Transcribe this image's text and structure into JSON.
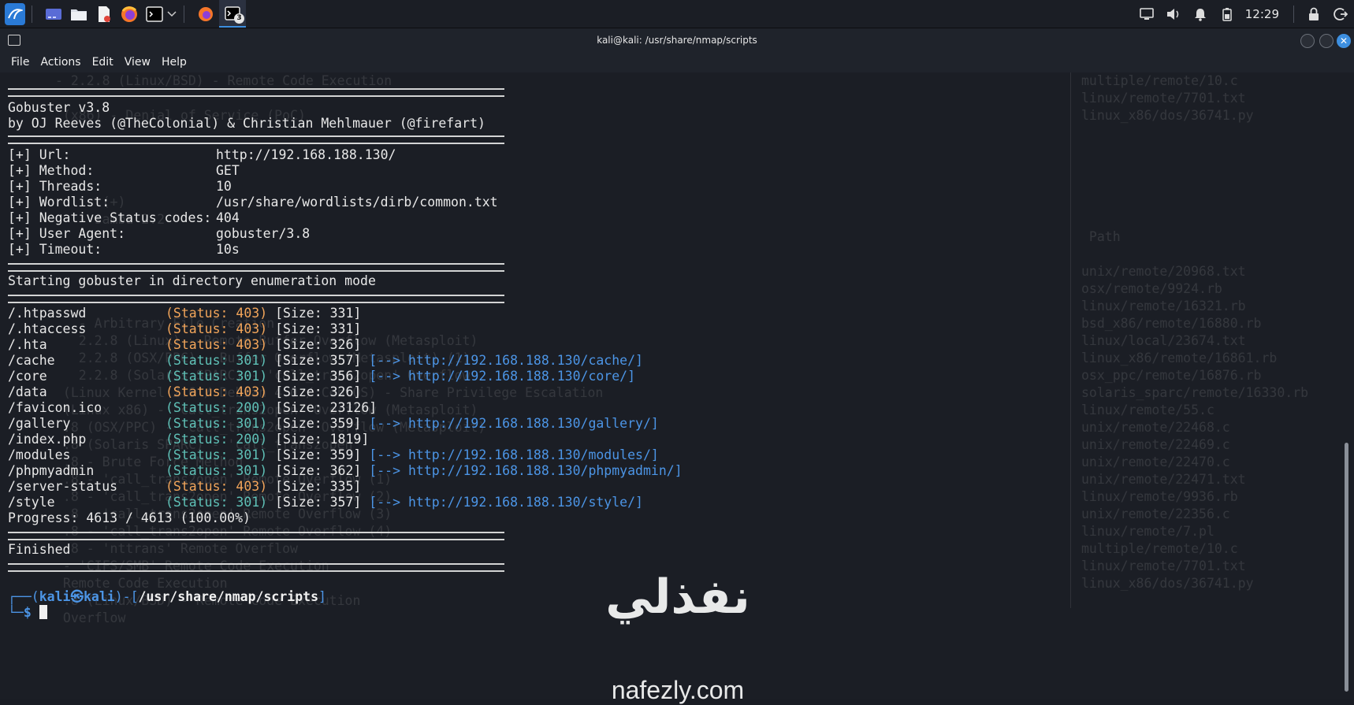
{
  "taskbar": {
    "clock": "12:29",
    "task_badge": "3"
  },
  "window": {
    "title": "kali@kali: /usr/share/nmap/scripts",
    "close_glyph": "✕"
  },
  "menu": [
    "File",
    "Actions",
    "Edit",
    "View",
    "Help"
  ],
  "terminal": {
    "header_line1": "Gobuster v3.8",
    "header_line2": "by OJ Reeves (@TheColonial) & Christian Mehlmauer (@firefart)",
    "config": [
      {
        "key": "[+] Url:",
        "value": "http://192.168.188.130/"
      },
      {
        "key": "[+] Method:",
        "value": "GET"
      },
      {
        "key": "[+] Threads:",
        "value": "10"
      },
      {
        "key": "[+] Wordlist:",
        "value": "/usr/share/wordlists/dirb/common.txt"
      },
      {
        "key": "[+] Negative Status codes:",
        "value": "404"
      },
      {
        "key": "[+] User Agent:",
        "value": "gobuster/3.8"
      },
      {
        "key": "[+] Timeout:",
        "value": "10s"
      }
    ],
    "start_msg": "Starting gobuster in directory enumeration mode",
    "results": [
      {
        "path": "/.htpasswd",
        "status": "(Status: 403)",
        "size": "[Size: 331]",
        "redirect": "",
        "kind": "403"
      },
      {
        "path": "/.htaccess",
        "status": "(Status: 403)",
        "size": "[Size: 331]",
        "redirect": "",
        "kind": "403"
      },
      {
        "path": "/.hta",
        "status": "(Status: 403)",
        "size": "[Size: 326]",
        "redirect": "",
        "kind": "403"
      },
      {
        "path": "/cache",
        "status": "(Status: 301)",
        "size": "[Size: 357]",
        "redirect": "http://192.168.188.130/cache/",
        "kind": "301"
      },
      {
        "path": "/core",
        "status": "(Status: 301)",
        "size": "[Size: 356]",
        "redirect": "http://192.168.188.130/core/",
        "kind": "301"
      },
      {
        "path": "/data",
        "status": "(Status: 403)",
        "size": "[Size: 326]",
        "redirect": "",
        "kind": "403"
      },
      {
        "path": "/favicon.ico",
        "status": "(Status: 200)",
        "size": "[Size: 23126]",
        "redirect": "",
        "kind": "200"
      },
      {
        "path": "/gallery",
        "status": "(Status: 301)",
        "size": "[Size: 359]",
        "redirect": "http://192.168.188.130/gallery/",
        "kind": "301"
      },
      {
        "path": "/index.php",
        "status": "(Status: 200)",
        "size": "[Size: 1819]",
        "redirect": "",
        "kind": "200"
      },
      {
        "path": "/modules",
        "status": "(Status: 301)",
        "size": "[Size: 359]",
        "redirect": "http://192.168.188.130/modules/",
        "kind": "301"
      },
      {
        "path": "/phpmyadmin",
        "status": "(Status: 301)",
        "size": "[Size: 362]",
        "redirect": "http://192.168.188.130/phpmyadmin/",
        "kind": "301"
      },
      {
        "path": "/server-status",
        "status": "(Status: 403)",
        "size": "[Size: 335]",
        "redirect": "",
        "kind": "403"
      },
      {
        "path": "/style",
        "status": "(Status: 301)",
        "size": "[Size: 357]",
        "redirect": "http://192.168.188.130/style/",
        "kind": "301"
      }
    ],
    "progress": "Progress: 4613 / 4613 (100.00%)",
    "finished": "Finished",
    "prompt": {
      "user_host": "kali㉿kali",
      "path": "/usr/share/nmap/scripts",
      "symbol": "$"
    }
  },
  "ghost_text": {
    "left": [
      "- 2.2.8 (Linux/BSD) - Remote Code Execution",
      "",
      " (x86) - Denial of Service (PoC)",
      "",
      "",
      "",
      "",
      "      (+)",
      "   - samba 2.2",
      "",
      "",
      "",
      "",
      "",
      "   - Arbitrary File Creation",
      "   2.2.8 (Linux) - Remote Buffer Overflow (Metasploit)",
      "   2.2.8 (OSX/PPC) - Buffer Overflow (Metasploit) (1)",
      "   2.2.8 (Solaris SPARC) - 'call_trans2open' Overflow",
      " (Linux Kernel 2.6 / Debian 4.0 / CentOS) - Share Privilege Escalation",
      " (Linux x86) - 'call_trans2open' Overflow (Metasploit)",
      " .8 (OSX/PPC) - 'call_trans2open' Overflow (Metasploit)",
      " .8 (Solaris SPARC) - 'call_trans2open'",
      " .8 - Brute Force Method",
      " .8 - 'call_trans2open' Remote Overflow (1)",
      " .8 - 'call_trans2open' Remote Overflow (2)",
      " .8 - 'call_trans2open' Remote Overflow (3)",
      " .8 - 'call_trans2open' Remote Overflow (4)",
      " .8 - 'nttrans' Remote Overflow",
      " - 'CIFS/SMB' Remote Code Execution",
      " Remote Code Execution",
      " .8 (Linux/BSD) - Remote Code Execution",
      " Overflow"
    ],
    "right": [
      "multiple/remote/10.c",
      "linux/remote/7701.txt",
      "linux_x86/dos/36741.py",
      "",
      "",
      "",
      "",
      "",
      "",
      " Path",
      "",
      "unix/remote/20968.txt",
      "osx/remote/9924.rb",
      "linux/remote/16321.rb",
      "bsd_x86/remote/16880.rb",
      "linux/local/23674.txt",
      "linux_x86/remote/16861.rb",
      "osx_ppc/remote/16876.rb",
      "solaris_sparc/remote/16330.rb",
      "linux/remote/55.c",
      "unix/remote/22468.c",
      "unix/remote/22469.c",
      "unix/remote/22470.c",
      "unix/remote/22471.txt",
      "linux/remote/9936.rb",
      "unix/remote/22356.c",
      "linux/remote/7.pl",
      "multiple/remote/10.c",
      "linux/remote/7701.txt",
      "linux_x86/dos/36741.py"
    ]
  },
  "watermark": {
    "arabic": "نفذلي",
    "latin": "nafezly.com"
  }
}
